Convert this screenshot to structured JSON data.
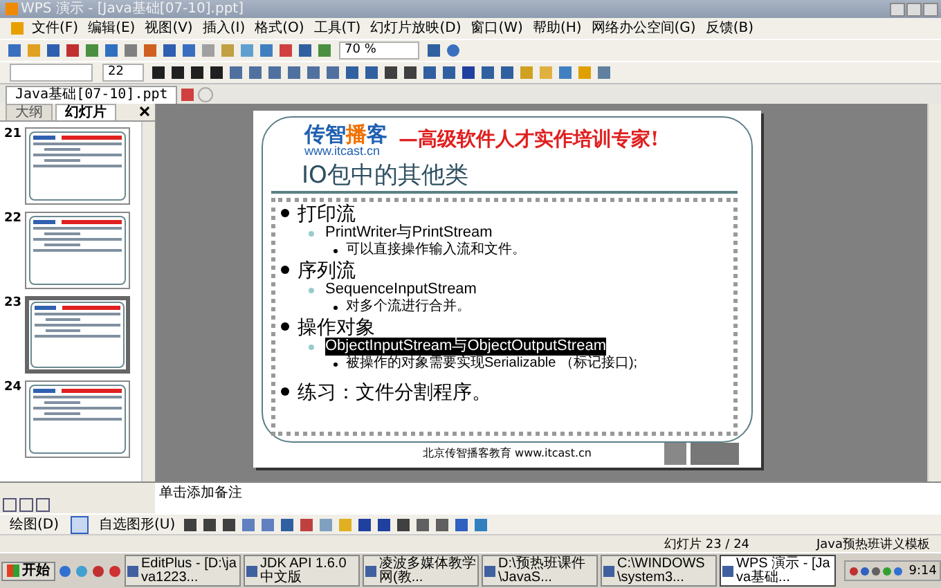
{
  "window": {
    "title": "WPS 演示 - [Java基础[07-10].ppt]"
  },
  "menu": [
    "文件(F)",
    "编辑(E)",
    "视图(V)",
    "插入(I)",
    "格式(O)",
    "工具(T)",
    "幻灯片放映(D)",
    "窗口(W)",
    "帮助(H)",
    "网络办公空间(G)",
    "反馈(B)"
  ],
  "toolbar": {
    "zoom": "70 %",
    "font_size": "22"
  },
  "document_tab": {
    "label": "Java基础[07-10].ppt"
  },
  "panel_tabs": [
    {
      "label": "大纲",
      "selected": false
    },
    {
      "label": "幻灯片",
      "selected": true
    }
  ],
  "thumbnails": [
    {
      "number": "21",
      "selected": false
    },
    {
      "number": "22",
      "selected": false
    },
    {
      "number": "23",
      "selected": true
    },
    {
      "number": "24",
      "selected": false
    }
  ],
  "slide": {
    "brand": "传智播客",
    "url": "www.itcast.cn",
    "slogan": "—高级软件人才实作培训专家!",
    "title": "IO包中的其他类",
    "bullets": [
      {
        "text": "打印流",
        "highlighted": false,
        "children": [
          {
            "text": "PrintWriter与PrintStream",
            "highlighted": false,
            "children": [
              {
                "text": "可以直接操作输入流和文件。",
                "highlighted": false
              }
            ]
          }
        ]
      },
      {
        "text": "序列流",
        "highlighted": false,
        "children": [
          {
            "text": "SequenceInputStream",
            "highlighted": false,
            "children": [
              {
                "text": "对多个流进行合并。",
                "highlighted": false
              }
            ]
          }
        ]
      },
      {
        "text": "操作对象",
        "highlighted": false,
        "children": [
          {
            "text": "ObjectInputStream与ObjectOutputStream",
            "highlighted": true,
            "children": [
              {
                "text": "被操作的对象需要实现Serializable （标记接口);",
                "highlighted": false
              }
            ]
          }
        ]
      },
      {
        "text": "练习：文件分割程序。",
        "highlighted": false
      }
    ],
    "footer": "北京传智播客教育 www.itcast.cn"
  },
  "notes": {
    "placeholder": "单击添加备注"
  },
  "drawing_toolbar": {
    "draw": "绘图(D)",
    "autoshapes": "自选图形(U)"
  },
  "status_bar": {
    "slide_count": "幻灯片 23 / 24",
    "template": "Java预热班讲义模板"
  },
  "taskbar": {
    "start": "开始",
    "items": [
      {
        "label": "EditPlus - [D:\\java1223...",
        "selected": false
      },
      {
        "label": "JDK API 1.6.0 中文版",
        "selected": false
      },
      {
        "label": "凌波多媒体教学网(教...",
        "selected": false
      },
      {
        "label": "D:\\预热班课件\\JavaS...",
        "selected": false
      },
      {
        "label": "C:\\WINDOWS\\system3...",
        "selected": false
      },
      {
        "label": "WPS 演示 - [Java基础...",
        "selected": true
      }
    ],
    "clock": "9:14"
  }
}
